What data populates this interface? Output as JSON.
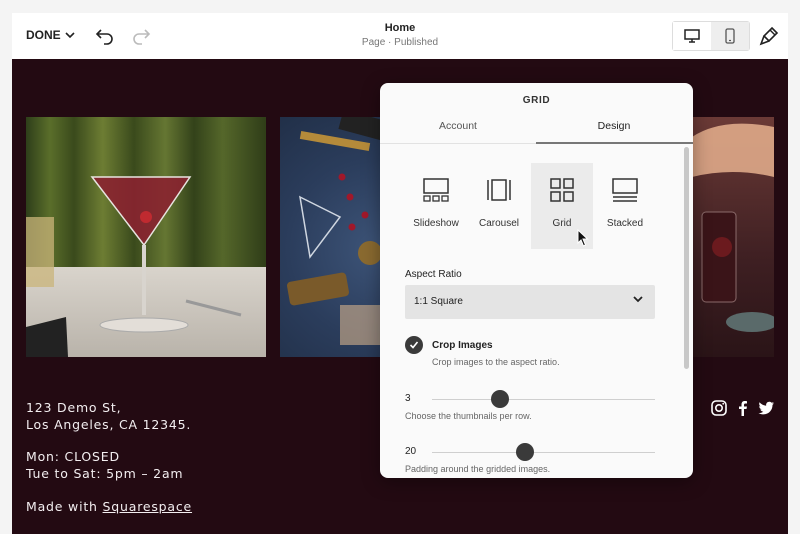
{
  "toolbar": {
    "done_label": "DONE",
    "page_title": "Home",
    "page_status": "Page · Published"
  },
  "site": {
    "address_line1": "123 Demo St,",
    "address_line2": "Los Angeles, CA 12345.",
    "hours_line1": "Mon: CLOSED",
    "hours_line2": "Tue to Sat: 5pm – 2am",
    "made_with": "Made with ",
    "made_with_link": "Squarespace"
  },
  "panel": {
    "title": "GRID",
    "tabs": {
      "account": "Account",
      "design": "Design"
    },
    "layouts": {
      "slideshow": "Slideshow",
      "carousel": "Carousel",
      "grid": "Grid",
      "stacked": "Stacked"
    },
    "aspect_ratio_label": "Aspect Ratio",
    "aspect_ratio_value": "1:1 Square",
    "crop_title": "Crop Images",
    "crop_desc": "Crop images to the aspect ratio.",
    "thumbs_value": "3",
    "thumbs_desc": "Choose the thumbnails per row.",
    "padding_value": "20",
    "padding_desc": "Padding around the gridded images."
  }
}
